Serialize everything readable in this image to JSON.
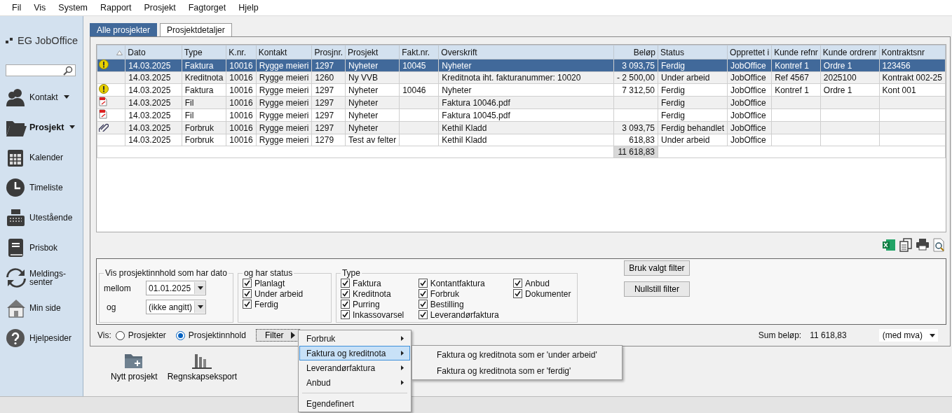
{
  "menubar": [
    "Fil",
    "Vis",
    "System",
    "Rapport",
    "Prosjekt",
    "Fagtorget",
    "Hjelp"
  ],
  "sidebar": {
    "logo": "EG JobOffice",
    "items": [
      {
        "label": "Kontakt",
        "dropdown": true,
        "selected": false
      },
      {
        "label": "Prosjekt",
        "dropdown": true,
        "selected": true
      },
      {
        "label": "Kalender",
        "dropdown": false,
        "selected": false
      },
      {
        "label": "Timeliste",
        "dropdown": false,
        "selected": false
      },
      {
        "label": "Utestående",
        "dropdown": false,
        "selected": false
      },
      {
        "label": "Prisbok",
        "dropdown": false,
        "selected": false
      },
      {
        "label": "Meldings-senter",
        "dropdown": false,
        "selected": false
      },
      {
        "label": "Min side",
        "dropdown": false,
        "selected": false
      },
      {
        "label": "Hjelpesider",
        "dropdown": false,
        "selected": false
      }
    ]
  },
  "tabs": [
    {
      "label": "Alle prosjekter",
      "selected": true
    },
    {
      "label": "Prosjektdetaljer",
      "selected": false
    }
  ],
  "table": {
    "columns": [
      "Dato",
      "Type",
      "K.nr.",
      "Kontakt",
      "Prosjnr.",
      "Prosjekt",
      "Fakt.nr.",
      "Overskrift",
      "Beløp",
      "Status",
      "Opprettet i",
      "Kunde refnr",
      "Kunde ordrenr",
      "Kontraktsnr"
    ],
    "rows": [
      {
        "kind": "warning",
        "selected": true,
        "cells": [
          "14.03.2025",
          "Faktura",
          "10016",
          "Rygge meieri",
          "1297",
          "Nyheter",
          "10045",
          "Nyheter",
          "3 093,75",
          "Ferdig",
          "JobOffice",
          "Kontref 1",
          "Ordre 1",
          "123456"
        ]
      },
      {
        "kind": "plain",
        "selected": false,
        "cells": [
          "14.03.2025",
          "Kreditnota",
          "10016",
          "Rygge meieri",
          "1260",
          "Ny VVB",
          "",
          "Kreditnota iht. fakturanummer: 10020",
          "- 2 500,00",
          "Under arbeid",
          "JobOffice",
          "Ref 4567",
          "2025100",
          "Kontrakt 002-25"
        ]
      },
      {
        "kind": "warning",
        "selected": false,
        "cells": [
          "14.03.2025",
          "Faktura",
          "10016",
          "Rygge meieri",
          "1297",
          "Nyheter",
          "10046",
          "Nyheter",
          "7 312,50",
          "Ferdig",
          "JobOffice",
          "Kontref 1",
          "Ordre 1",
          "Kont 001"
        ]
      },
      {
        "kind": "pdf",
        "selected": false,
        "cells": [
          "14.03.2025",
          "Fil",
          "10016",
          "Rygge meieri",
          "1297",
          "Nyheter",
          "",
          " Faktura 10046.pdf",
          "",
          "Ferdig",
          "JobOffice",
          "",
          "",
          ""
        ]
      },
      {
        "kind": "pdf",
        "selected": false,
        "cells": [
          "14.03.2025",
          "Fil",
          "10016",
          "Rygge meieri",
          "1297",
          "Nyheter",
          "",
          " Faktura 10045.pdf",
          "",
          "Ferdig",
          "JobOffice",
          "",
          "",
          ""
        ]
      },
      {
        "kind": "attachment",
        "selected": false,
        "cells": [
          "14.03.2025",
          "Forbruk",
          "10016",
          "Rygge meieri",
          "1297",
          "Nyheter",
          "",
          " Kethil Kladd",
          "3 093,75",
          "Ferdig behandlet",
          "JobOffice",
          "",
          "",
          ""
        ]
      },
      {
        "kind": "plain",
        "selected": false,
        "cells": [
          "14.03.2025",
          "Forbruk",
          "10016",
          "Rygge meieri",
          "1279",
          "Test av felter",
          "",
          " Kethil Kladd",
          "618,83",
          "Under arbeid",
          "JobOffice",
          "",
          "",
          ""
        ]
      }
    ],
    "total": "11 618,83"
  },
  "filter": {
    "date_group": {
      "title": "Vis prosjektinnhold som har dato",
      "from_label": "mellom",
      "from": "01.01.2025",
      "to_label": "og",
      "to": "(ikke angitt)"
    },
    "status_group": {
      "title": "og har status",
      "options": [
        {
          "label": "Planlagt",
          "checked": true
        },
        {
          "label": "Under arbeid",
          "checked": true
        },
        {
          "label": "Ferdig",
          "checked": true
        }
      ]
    },
    "type_group": {
      "title": "Type",
      "options": [
        {
          "label": "Faktura",
          "checked": true
        },
        {
          "label": "Kreditnota",
          "checked": true
        },
        {
          "label": "Purring",
          "checked": true
        },
        {
          "label": "Inkassovarsel",
          "checked": true
        },
        {
          "label": "Kontantfaktura",
          "checked": true
        },
        {
          "label": "Forbruk",
          "checked": true
        },
        {
          "label": "Bestilling",
          "checked": true
        },
        {
          "label": "Leverandørfaktura",
          "checked": true
        },
        {
          "label": "Anbud",
          "checked": true
        },
        {
          "label": "Dokumenter",
          "checked": true
        }
      ]
    },
    "buttons": [
      "Bruk valgt filter",
      "Nullstill filter"
    ]
  },
  "view": {
    "label": "Vis:",
    "options": [
      {
        "label": "Prosjekter",
        "selected": false
      },
      {
        "label": "Prosjektinnhold",
        "selected": true
      }
    ],
    "filter_button": "Filter",
    "sum_label": "Sum beløp:",
    "sum_value": "11 618,83",
    "vat_select": "(med mva)"
  },
  "filter_menu": {
    "items": [
      {
        "label": "Forbruk",
        "kind": "submenu",
        "selected": false
      },
      {
        "label": "Faktura og kreditnota",
        "kind": "submenu",
        "selected": true
      },
      {
        "label": "Leverandørfaktura",
        "kind": "submenu",
        "selected": false
      },
      {
        "label": "Anbud",
        "kind": "submenu",
        "selected": false
      },
      {
        "label": "Egendefinert",
        "kind": "item",
        "selected": false
      }
    ],
    "submenu": [
      "Faktura og kreditnota som er 'under arbeid'",
      "Faktura og kreditnota som er 'ferdig'"
    ]
  },
  "toolbar": [
    "Nytt prosjekt",
    "Regnskapseksport"
  ]
}
